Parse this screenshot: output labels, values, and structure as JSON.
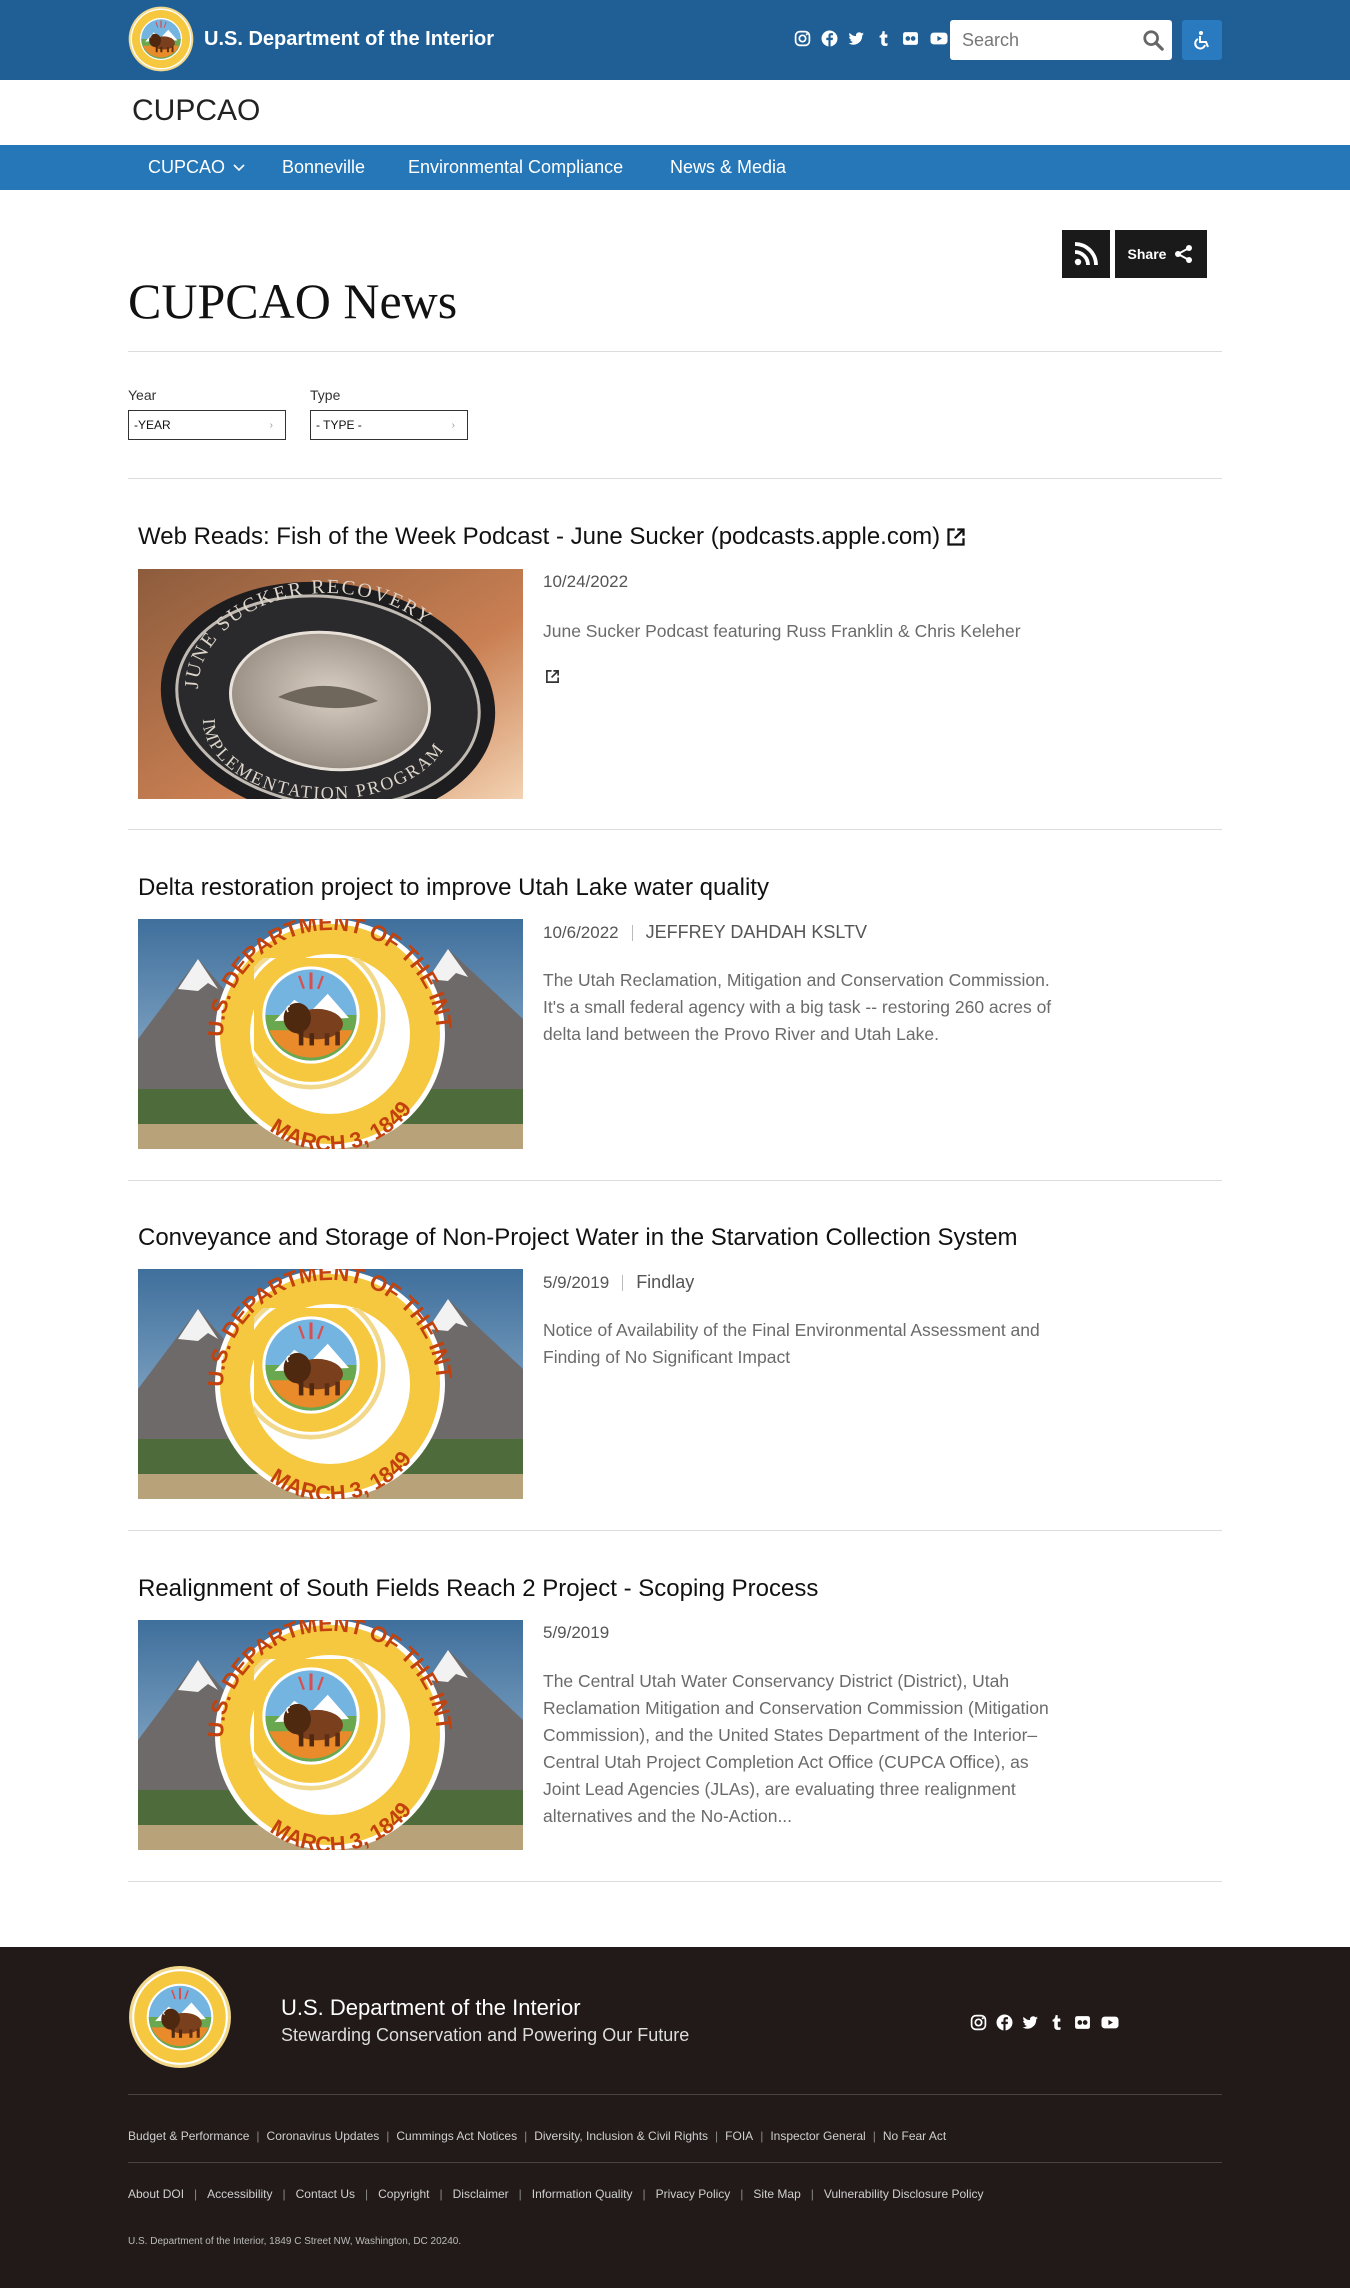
{
  "header": {
    "site_name": "U.S. Department of the Interior",
    "search_placeholder": "Search",
    "social_icons": [
      "instagram-icon",
      "facebook-icon",
      "twitter-icon",
      "tumblr-icon",
      "flickr-icon",
      "youtube-icon"
    ],
    "accessibility_icon": "accessibility-icon"
  },
  "subsite": {
    "title": "CUPCAO"
  },
  "nav": {
    "items": [
      {
        "label": "CUPCAO",
        "has_dropdown": true
      },
      {
        "label": "Bonneville"
      },
      {
        "label": "Environmental Compliance"
      },
      {
        "label": "News & Media"
      }
    ]
  },
  "page": {
    "title": "CUPCAO News",
    "share_label": "Share",
    "filters": {
      "year_label": "Year",
      "year_value": "-YEAR",
      "type_label": "Type",
      "type_value": "- TYPE -"
    }
  },
  "articles": [
    {
      "title": "Web Reads: Fish of the Week Podcast - June Sucker (podcasts.apple.com)",
      "external": true,
      "date": "10/24/2022",
      "author": "",
      "description": "June Sucker Podcast featuring Russ Franklin & Chris Keleher",
      "image": "june-sucker-coin-photo",
      "image_text_top": "JUNE SUCKER RECOVERY",
      "image_text_bottom": "IMPLEMENTATION PROGRAM"
    },
    {
      "title": "Delta restoration project to improve Utah Lake water quality",
      "external": false,
      "date": "10/6/2022",
      "author": "JEFFREY DAHDAH KSLTV",
      "description": "The Utah Reclamation, Mitigation and Conservation Commission. It's a small federal agency with a big task -- restoring 260 acres of delta land between the Provo River and Utah Lake.",
      "image": "doi-seal-mountains"
    },
    {
      "title": "Conveyance and Storage of Non-Project Water in the Starvation Collection System",
      "external": false,
      "date": "5/9/2019",
      "author": "Findlay",
      "description": "Notice of Availability of the Final Environmental Assessment and Finding of No Significant Impact",
      "image": "doi-seal-mountains"
    },
    {
      "title": "Realignment of South Fields Reach 2 Project - Scoping Process",
      "external": false,
      "date": "5/9/2019",
      "author": "",
      "description": "The Central Utah Water Conservancy District (District), Utah Reclamation Mitigation and Conservation Commission (Mitigation Commission), and the United States Department of the Interior–Central Utah Project Completion Act Office (CUPCA Office), as Joint Lead Agencies (JLAs), are evaluating three realignment alternatives and the No-Action...",
      "image": "doi-seal-mountains"
    }
  ],
  "seal_text": {
    "ring": "U.S. DEPARTMENT OF THE INTERIOR",
    "date": "MARCH 3, 1849"
  },
  "footer": {
    "title": "U.S. Department of the Interior",
    "tagline": "Stewarding Conservation and Powering Our Future",
    "links_row1": [
      "Budget & Performance",
      "Coronavirus Updates",
      "Cummings Act Notices",
      "Diversity, Inclusion & Civil Rights",
      "FOIA",
      "Inspector General",
      "No Fear Act"
    ],
    "links_row2": [
      "About DOI",
      "Accessibility",
      "Contact Us",
      "Copyright",
      "Disclaimer",
      "Information Quality",
      "Privacy Policy",
      "Site Map",
      "Vulnerability Disclosure Policy"
    ],
    "address": "U.S. Department of the Interior, 1849 C Street NW, Washington, DC 20240."
  },
  "colors": {
    "topbar": "#1f5f95",
    "nav": "#2677b8",
    "footer": "#211a18",
    "dark_button": "#1a1a1a"
  }
}
